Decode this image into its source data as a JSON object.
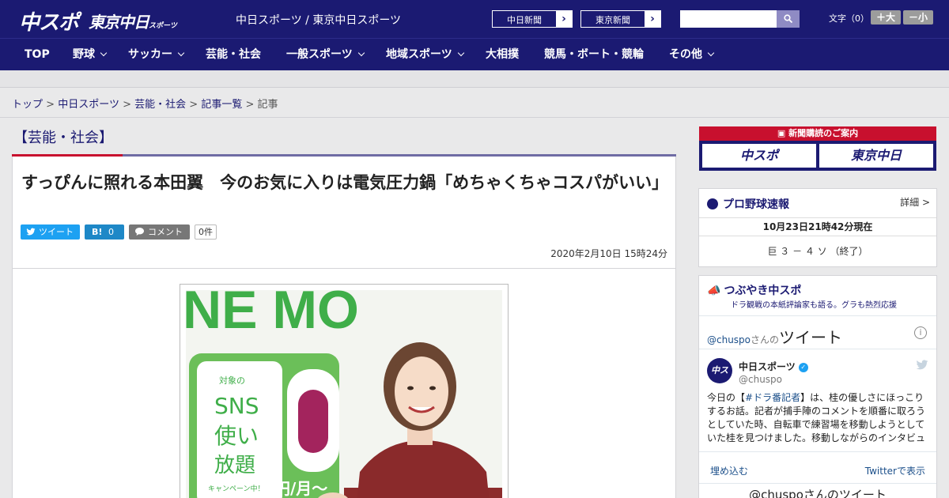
{
  "header": {
    "logo_chuspo": "中スポ",
    "logo_tokyo": "東京中日",
    "logo_tokyo_small": "スポーツ",
    "site_name": "中日スポーツ / 東京中日スポーツ",
    "paper_buttons": [
      "中日新聞",
      "東京新聞"
    ],
    "search_placeholder": "",
    "font_size_label": "文字（0）",
    "font_plus": "＋大",
    "font_minus": "－小"
  },
  "nav": {
    "items": [
      "TOP",
      "野球",
      "サッカー",
      "芸能・社会",
      "一般スポーツ",
      "地域スポーツ",
      "大相撲",
      "競馬・ボート・競輪",
      "その他"
    ]
  },
  "breadcrumb": {
    "items": [
      "トップ",
      "中日スポーツ",
      "芸能・社会",
      "記事一覧"
    ],
    "current": "記事",
    "separator": ">"
  },
  "article": {
    "category": "【芸能・社会】",
    "title": "すっぴんに照れる本田翼　今のお気に入りは電気圧力鍋「めちゃくちゃコスパがいい」",
    "tweet_label": "ツイート",
    "hatena_label": "B!",
    "hatena_count": "0",
    "comment_label": "コメント",
    "comment_count": "0件",
    "date": "2020年2月10日 15時24分",
    "photo_sign_lines": [
      "対象の",
      "SNS",
      "使い",
      "放題",
      "キャンペーン中！"
    ],
    "photo_banner_text": "NE MO",
    "photo_price": "円/月～"
  },
  "sidebar": {
    "ad_header": "新聞購読のご案内",
    "ad_buttons": [
      "中スポ",
      "東京中日"
    ],
    "baseball": {
      "title": "プロ野球速報",
      "detail": "詳細 >",
      "time": "10月23日21時42分現在",
      "score": "巨 ３ － ４ ソ （終了）"
    },
    "twitter": {
      "title": "つぶやき中スポ",
      "subtitle": "ドラ観戦の本紙評論家も語る。グラも熱烈応援",
      "handle_prefix": "@chuspo",
      "handle_suffix": "さんの",
      "handle_big": "ツイート",
      "account_name": "中日スポーツ",
      "account_id": "@chuspo",
      "avatar_text": "中スポ",
      "tweet_pre": "今日の【",
      "tweet_tag": "#ドラ番記者",
      "tweet_post": "】は、桂の優しさにほっこりするお話。記者が捕手陣のコメントを順番に取ろうとしていた時、自転車で練習場を移動しようとしていた桂を見つけました。移動しながらのインタビュー",
      "embed": "埋め込む",
      "view_on_twitter": "Twitterで表示",
      "bottom": "@chuspoさんのツイート"
    }
  },
  "colors": {
    "brand_navy": "#1b1a72",
    "accent_red": "#c8102e"
  }
}
